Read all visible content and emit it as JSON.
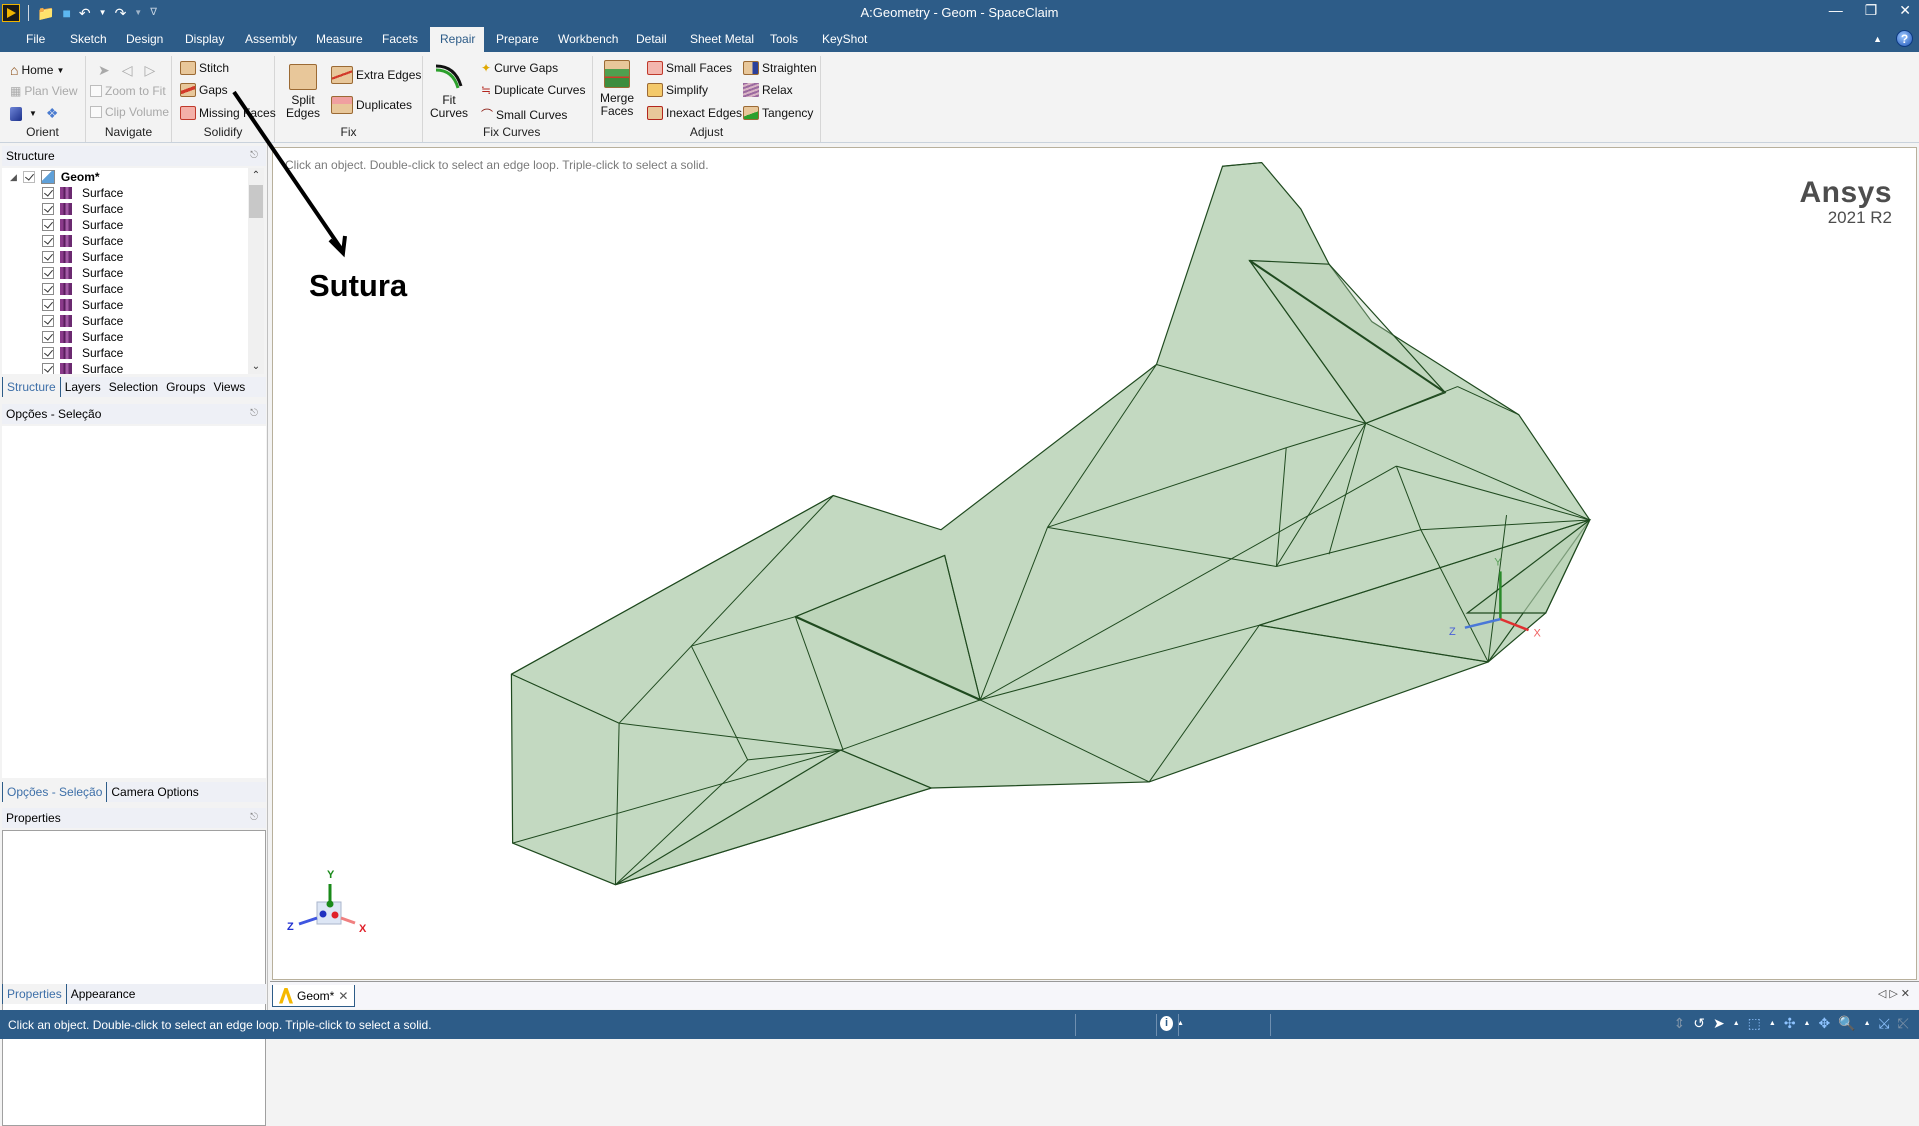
{
  "window": {
    "title": "A:Geometry - Geom - SpaceClaim",
    "controls": [
      "minimize",
      "restore",
      "close"
    ]
  },
  "quick_access": {
    "icons": [
      "spaceclaim-logo-icon",
      "open-folder-icon",
      "save-icon",
      "undo-icon",
      "redo-icon",
      "customize-icon"
    ]
  },
  "menu": {
    "tabs": [
      {
        "label": "File"
      },
      {
        "label": "Sketch"
      },
      {
        "label": "Design"
      },
      {
        "label": "Display"
      },
      {
        "label": "Assembly"
      },
      {
        "label": "Measure"
      },
      {
        "label": "Facets"
      },
      {
        "label": "Repair",
        "active": true
      },
      {
        "label": "Prepare"
      },
      {
        "label": "Workbench"
      },
      {
        "label": "Detail"
      },
      {
        "label": "Sheet Metal"
      },
      {
        "label": "Tools"
      },
      {
        "label": "KeyShot"
      }
    ],
    "help_label": "?"
  },
  "ribbon": {
    "orient": {
      "label": "Orient",
      "home": "Home",
      "plan_view": "Plan View"
    },
    "navigate": {
      "label": "Navigate",
      "zoom_to_fit": "Zoom to Fit",
      "clip_volume": "Clip Volume"
    },
    "solidify": {
      "label": "Solidify",
      "stitch": "Stitch",
      "gaps": "Gaps",
      "missing_faces": "Missing Faces"
    },
    "fix": {
      "label": "Fix",
      "split_edges": "Split Edges",
      "extra_edges": "Extra Edges",
      "duplicates": "Duplicates"
    },
    "fix_curves": {
      "label": "Fix Curves",
      "fit_curves": "Fit Curves",
      "curve_gaps": "Curve Gaps",
      "duplicate_curves": "Duplicate Curves",
      "small_curves": "Small Curves"
    },
    "adjust": {
      "label": "Adjust",
      "merge_faces": "Merge Faces",
      "small_faces": "Small Faces",
      "simplify": "Simplify",
      "inexact_edges": "Inexact Edges",
      "straighten": "Straighten",
      "relax": "Relax",
      "tangency": "Tangency"
    }
  },
  "structure_panel": {
    "title": "Structure",
    "root": {
      "label": "Geom*",
      "checked": true
    },
    "items": [
      {
        "label": "Surface",
        "checked": true
      },
      {
        "label": "Surface",
        "checked": true
      },
      {
        "label": "Surface",
        "checked": true
      },
      {
        "label": "Surface",
        "checked": true
      },
      {
        "label": "Surface",
        "checked": true
      },
      {
        "label": "Surface",
        "checked": true
      },
      {
        "label": "Surface",
        "checked": true
      },
      {
        "label": "Surface",
        "checked": true
      },
      {
        "label": "Surface",
        "checked": true
      },
      {
        "label": "Surface",
        "checked": true
      },
      {
        "label": "Surface",
        "checked": true
      },
      {
        "label": "Surface",
        "checked": true
      }
    ],
    "tabs": [
      "Structure",
      "Layers",
      "Selection",
      "Groups",
      "Views"
    ],
    "active_tab": "Structure"
  },
  "options_panel": {
    "title": "Opções - Seleção",
    "tabs": [
      "Opções - Seleção",
      "Camera Options"
    ],
    "active_tab": "Opções - Seleção"
  },
  "properties_panel": {
    "title": "Properties",
    "tabs": [
      "Properties",
      "Appearance"
    ],
    "active_tab": "Properties"
  },
  "viewport": {
    "hint": "Click an object. Double-click to select an edge loop. Triple-click to select a solid.",
    "brand": "Ansys",
    "version": "2021 R2",
    "annotation": "Sutura",
    "axis_labels": {
      "x": "X",
      "y": "Y",
      "z": "Z"
    },
    "model_color": "#b9d2b6",
    "edge_color": "#1f4a1f"
  },
  "document_tabs": [
    {
      "label": "Geom*",
      "active": true
    }
  ],
  "status_bar": {
    "message": "Click an object. Double-click to select an edge loop. Triple-click to select a solid.",
    "info_label": "i"
  },
  "colors": {
    "chrome": "#2d5c88",
    "panel": "#f3f3f3",
    "accent_text": "#3d6fa8"
  }
}
